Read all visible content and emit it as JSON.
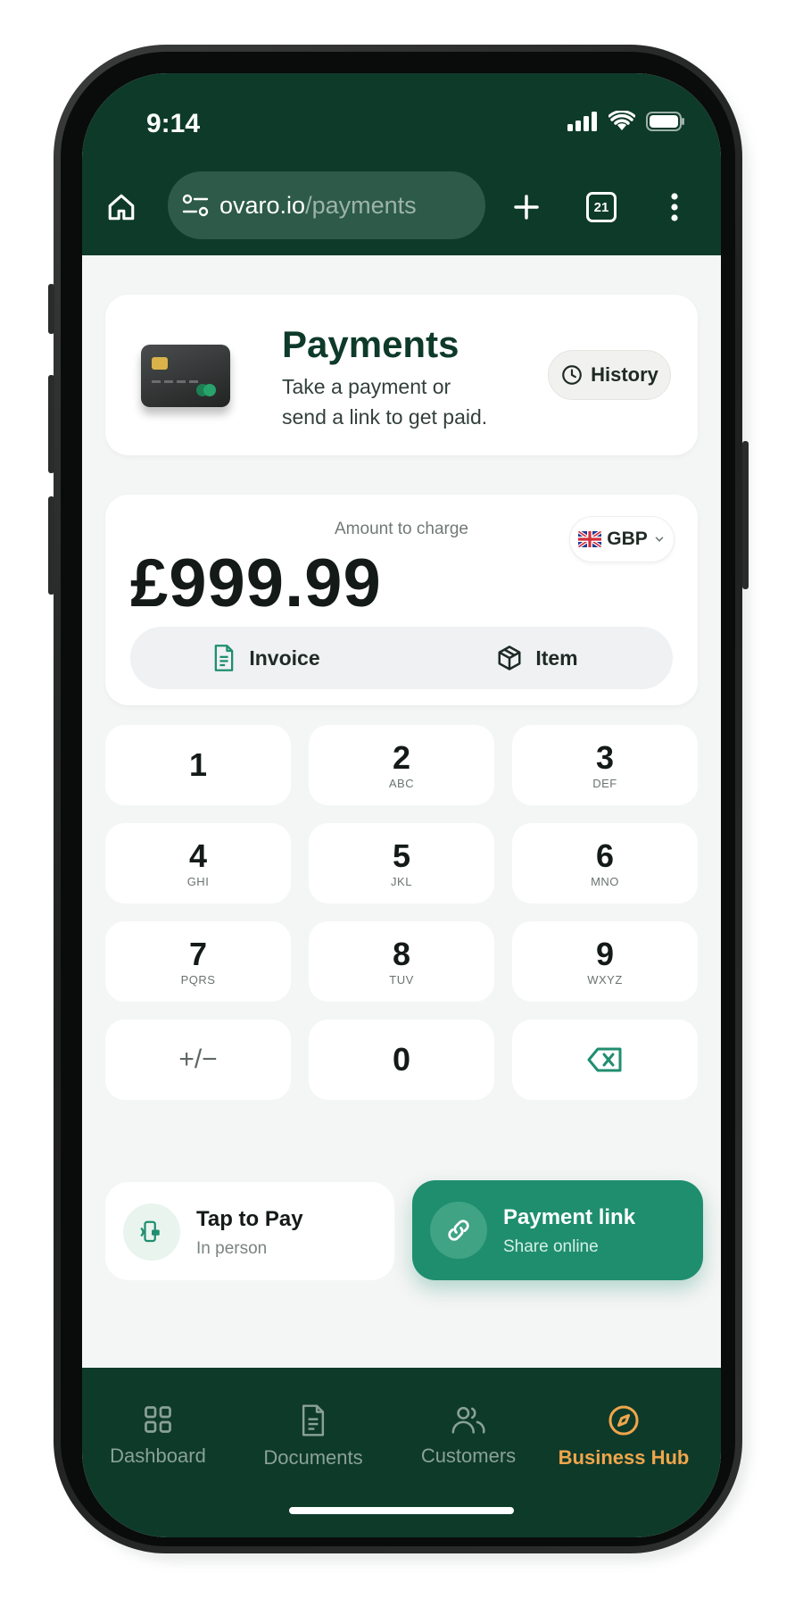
{
  "status_bar": {
    "time": "9:14"
  },
  "browser": {
    "url_domain": "ovaro.io",
    "url_path": "/payments",
    "tab_count": "21"
  },
  "header": {
    "title": "Payments",
    "subtitle": "Take a payment or send a link to get paid.",
    "history_label": "History"
  },
  "amount": {
    "label": "Amount to charge",
    "value": "£999.99",
    "currency": "GBP",
    "segments": [
      {
        "label": "Invoice",
        "icon": "document-icon"
      },
      {
        "label": "Item",
        "icon": "box-icon"
      }
    ]
  },
  "keypad": [
    {
      "num": "1",
      "sub": ""
    },
    {
      "num": "2",
      "sub": "ABC"
    },
    {
      "num": "3",
      "sub": "DEF"
    },
    {
      "num": "4",
      "sub": "GHI"
    },
    {
      "num": "5",
      "sub": "JKL"
    },
    {
      "num": "6",
      "sub": "MNO"
    },
    {
      "num": "7",
      "sub": "PQRS"
    },
    {
      "num": "8",
      "sub": "TUV"
    },
    {
      "num": "9",
      "sub": "WXYZ"
    },
    {
      "num": "+/−",
      "sub": ""
    },
    {
      "num": "0",
      "sub": ""
    },
    {
      "num": "",
      "sub": "",
      "icon": "backspace-icon"
    }
  ],
  "actions": {
    "tap": {
      "title": "Tap to Pay",
      "subtitle": "In person"
    },
    "link": {
      "title": "Payment link",
      "subtitle": "Share online"
    }
  },
  "nav": [
    {
      "label": "Dashboard",
      "icon": "grid-icon"
    },
    {
      "label": "Documents",
      "icon": "document-icon"
    },
    {
      "label": "Customers",
      "icon": "users-icon"
    },
    {
      "label": "Business Hub",
      "icon": "compass-icon",
      "active": true
    }
  ],
  "colors": {
    "brand_dark": "#0e3a2a",
    "accent_green": "#1f8e6e",
    "active_nav": "#f0a64b"
  }
}
